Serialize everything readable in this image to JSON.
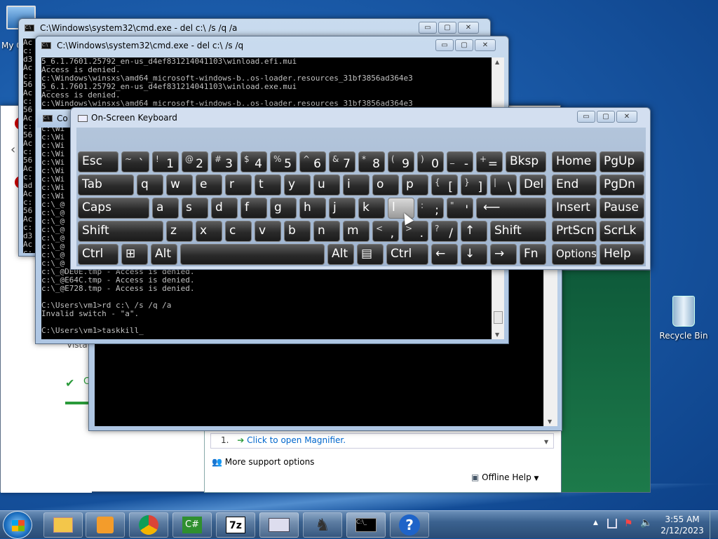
{
  "desktop": {
    "computer_label": "My C",
    "recycle_label": "Recycle Bin"
  },
  "cmd1": {
    "title": "C:\\Windows\\system32\\cmd.exe - del  c:\\ /s /q /a",
    "left_chars": [
      "Ac",
      "c:",
      "d3",
      "Ac",
      "c:",
      "56",
      "Ac",
      "c:",
      "56",
      "Ac",
      "c:",
      "56",
      "Ac",
      "c:",
      "56",
      "Ac",
      "c:",
      "ad",
      "Ac",
      "c:",
      "56",
      "Ac",
      "c:",
      "d3",
      "Ac",
      "c:",
      "4e"
    ]
  },
  "cmd2": {
    "title": "C:\\Windows\\system32\\cmd.exe - del  c:\\ /s /q",
    "lines": [
      "5_6.1.7601.25792_en-us_d4ef831214041103\\winload.efi.mui",
      "Access is denied.",
      "c:\\Windows\\winsxs\\amd64_microsoft-windows-b..os-loader.resources_31bf3856ad364e3",
      "5_6.1.7601.25792_en-us_d4ef831214041103\\winload.exe.mui",
      "Access is denied.",
      "c:\\Windows\\winsxs\\amd64_microsoft-windows-b..os-loader.resources_31bf3856ad364e3"
    ],
    "partial_lines": [
      "c:\\Wi",
      "c:\\Wi",
      "c:\\Wi",
      "c:\\Wi",
      "c:\\Wi",
      "c:\\Wi",
      "c:\\Wi",
      "c:\\Wi",
      "c:\\Wi",
      "c:\\_@",
      "c:\\_@",
      "c:\\_@",
      "c:\\_@",
      "c:\\_@",
      "c:\\_@",
      "c:\\_@",
      "c:\\_@"
    ],
    "bottom_lines": [
      "c:\\_@DE0E.tmp - Access is denied.",
      "c:\\_@E64C.tmp - Access is denied.",
      "c:\\_@E728.tmp - Access is denied.",
      "",
      "C:\\Users\\vm1>rd c:\\ /s /q /a",
      "Invalid switch - \"a\".",
      "",
      "C:\\Users\\vm1>taskkill_"
    ]
  },
  "cmd3": {
    "title_partial": "Co"
  },
  "osk": {
    "title": "On-Screen Keyboard"
  },
  "keys": {
    "esc": "Esc",
    "tilde_top": "~",
    "tilde_bot": "`",
    "k1t": "!",
    "k1": "1",
    "k2t": "@",
    "k2": "2",
    "k3t": "#",
    "k3": "3",
    "k4t": "$",
    "k4": "4",
    "k5t": "%",
    "k5": "5",
    "k6t": "^",
    "k6": "6",
    "k7t": "&",
    "k7": "7",
    "k8t": "*",
    "k8": "8",
    "k9t": "(",
    "k9": "9",
    "k0t": ")",
    "k0": "0",
    "minus_t": "_",
    "minus": "-",
    "eq_t": "+",
    "eq": "=",
    "bksp": "Bksp",
    "home": "Home",
    "pgup": "PgUp",
    "tab": "Tab",
    "q": "q",
    "w": "w",
    "e": "e",
    "r": "r",
    "t": "t",
    "y": "y",
    "u": "u",
    "i": "i",
    "o": "o",
    "p": "p",
    "lb_t": "{",
    "lb": "[",
    "rb_t": "}",
    "rb": "]",
    "bs_t": "|",
    "bs": "\\",
    "del": "Del",
    "end": "End",
    "pgdn": "PgDn",
    "caps": "Caps",
    "a": "a",
    "s": "s",
    "d": "d",
    "f": "f",
    "g": "g",
    "h": "h",
    "j": "j",
    "k": "k",
    "l": "l",
    "semi_t": ":",
    "semi": ";",
    "quote_t": "\"",
    "quote": "'",
    "enter": "⟵",
    "insert": "Insert",
    "pause": "Pause",
    "shift": "Shift",
    "z": "z",
    "x": "x",
    "c": "c",
    "v": "v",
    "b": "b",
    "n": "n",
    "m": "m",
    "comma_t": "<",
    "comma": ",",
    "dot_t": ">",
    "dot": ".",
    "slash_t": "?",
    "slash": "/",
    "up": "↑",
    "rshift": "Shift",
    "prtscn": "PrtScn",
    "scrlk": "ScrLk",
    "ctrl": "Ctrl",
    "win": "⊞",
    "alt": "Alt",
    "ralt": "Alt",
    "menu": "▤",
    "rctrl": "Ctrl",
    "left": "←",
    "down": "↓",
    "right": "→",
    "fn": "Fn",
    "options": "Options",
    "help": "Help"
  },
  "help": {
    "step_num": "1.",
    "step_link": "Click to open Magnifier.",
    "more": "More support options",
    "offline": "Offline Help"
  },
  "partial": {
    "vista": "Vista",
    "check_c": "C"
  },
  "clock": {
    "time": "3:55 AM",
    "date": "2/12/2023"
  },
  "colors": {
    "accent": "#1a5aa8",
    "link": "#0066cc"
  }
}
